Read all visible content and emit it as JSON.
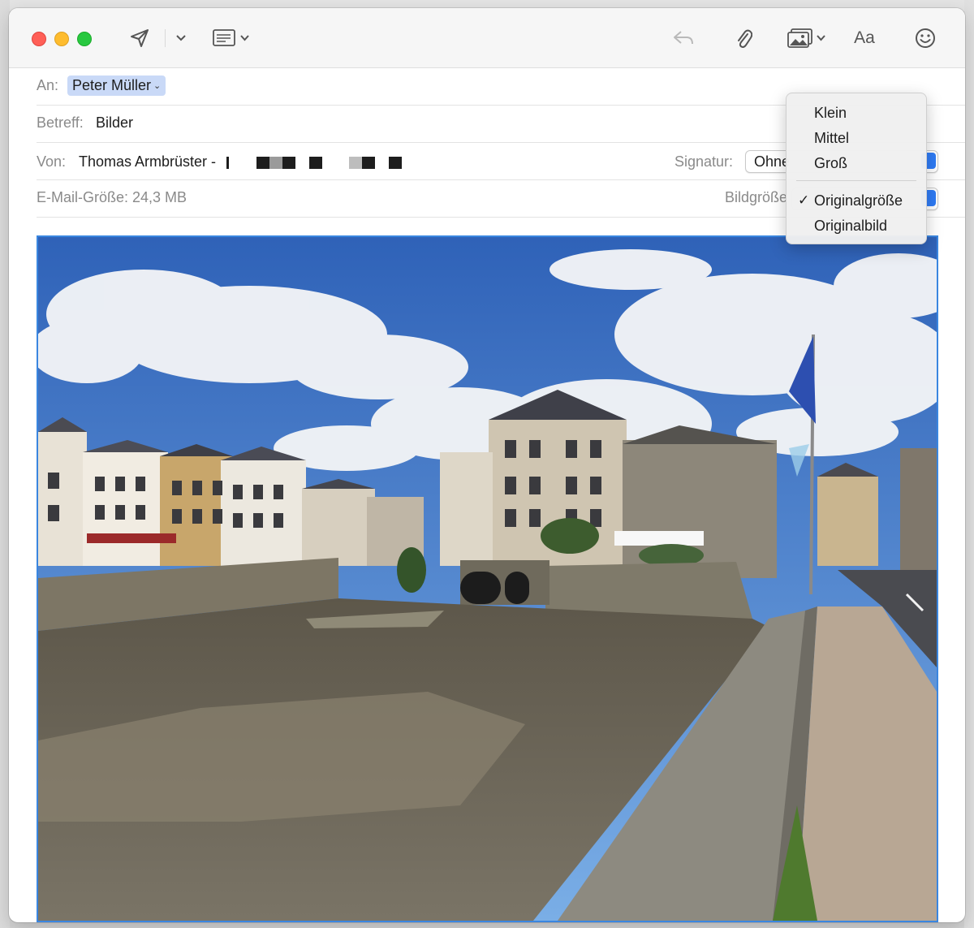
{
  "toolbar": {
    "send_icon": "paper-plane-icon",
    "format_icon": "header-fields-icon",
    "reply_icon": "reply-icon",
    "attach_icon": "paperclip-icon",
    "photo_icon": "photo-browser-icon",
    "font_label": "Aa",
    "emoji_icon": "smiley-icon"
  },
  "header": {
    "to_label": "An:",
    "to_value": "Peter Müller",
    "subject_label": "Betreff:",
    "subject_value": "Bilder",
    "from_label": "Von:",
    "from_value": "Thomas Armbrüster -",
    "signature_label": "Signatur:",
    "signature_value": "Ohne",
    "size_label": "E-Mail-Größe: 24,3 MB",
    "image_size_label": "Bildgröße"
  },
  "image_size_menu": {
    "items": [
      {
        "label": "Klein",
        "checked": false
      },
      {
        "label": "Mittel",
        "checked": false
      },
      {
        "label": "Groß",
        "checked": false
      },
      {
        "label": "Originalgröße",
        "checked": true
      },
      {
        "label": "Originalbild",
        "checked": false
      }
    ],
    "check_mark": "✓"
  },
  "colors": {
    "selection": "#c9d9f7",
    "accent": "#2f7cf6",
    "sky": "#3d74c9"
  }
}
